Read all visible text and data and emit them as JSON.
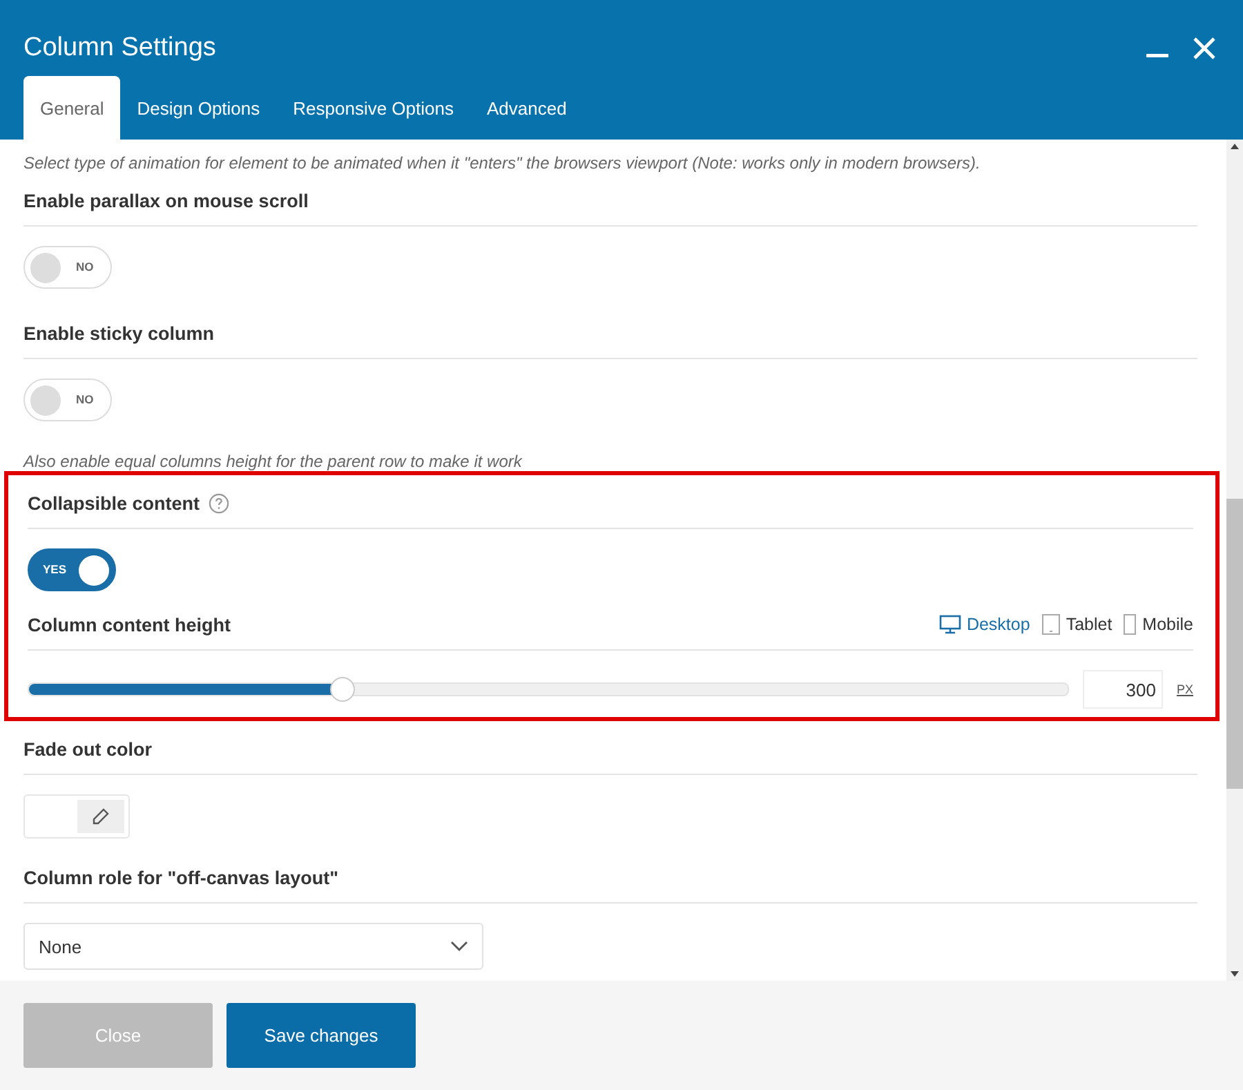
{
  "window": {
    "title": "Column Settings"
  },
  "tabs": [
    {
      "label": "General",
      "selected": true
    },
    {
      "label": "Design Options",
      "selected": false
    },
    {
      "label": "Responsive Options",
      "selected": false
    },
    {
      "label": "Advanced",
      "selected": false
    }
  ],
  "intro_note": "Select type of animation for element to be animated when it \"enters\" the browsers viewport (Note: works only in modern browsers).",
  "sections": [
    {
      "kind": "toggle",
      "label": "Enable parallax on mouse scroll",
      "on": false,
      "toggle_text": "NO"
    },
    {
      "kind": "toggle",
      "label": "Enable sticky column",
      "on": false,
      "toggle_text": "NO",
      "note": "Also enable equal columns height for the parent row to make it work"
    },
    {
      "kind": "highlight",
      "sections": [
        {
          "kind": "toggle",
          "label": "Collapsible content",
          "help": true,
          "on": true,
          "toggle_text": "YES"
        },
        {
          "kind": "slider",
          "label": "Column content height",
          "devices": [
            {
              "label": "Desktop",
              "kind": "desktop",
              "selected": true
            },
            {
              "label": "Tablet",
              "kind": "tablet",
              "selected": false
            },
            {
              "label": "Mobile",
              "kind": "mobile",
              "selected": false
            }
          ],
          "level": 0.3,
          "value": "300",
          "unit": "PX"
        }
      ]
    },
    {
      "kind": "color",
      "label": "Fade out color"
    },
    {
      "kind": "select",
      "label": "Column role for \"off-canvas layout\"",
      "value": "None"
    }
  ],
  "buttons": [
    {
      "label": "Close",
      "kind": "secondary"
    },
    {
      "label": "Save changes",
      "kind": "primary"
    }
  ]
}
